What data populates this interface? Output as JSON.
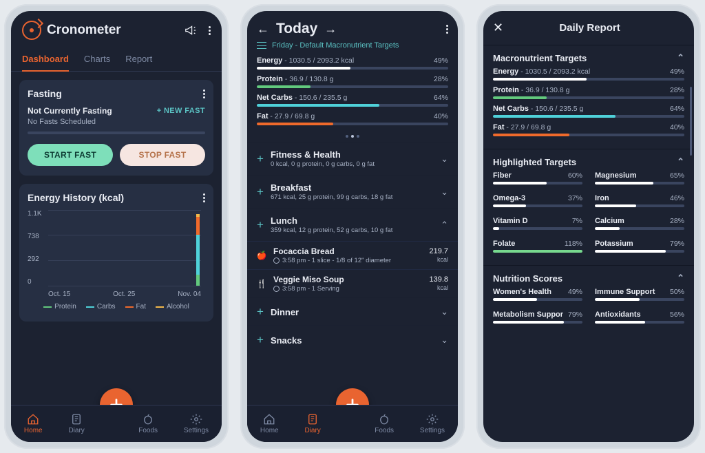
{
  "app_name": "Cronometer",
  "screen1": {
    "tabs": [
      "Dashboard",
      "Charts",
      "Report"
    ],
    "active_tab": 0,
    "fasting": {
      "title": "Fasting",
      "status": "Not Currently Fasting",
      "schedule": "No Fasts Scheduled",
      "new_fast": "+ NEW FAST",
      "start": "START FAST",
      "stop": "STOP FAST"
    },
    "energy_history": {
      "title": "Energy History (kcal)",
      "yticks": [
        "1.1K",
        "738",
        "292",
        "0"
      ],
      "xticks": [
        "Oct. 15",
        "Oct. 25",
        "Nov. 04"
      ],
      "legend": [
        {
          "name": "Protein",
          "color": "#62c97d"
        },
        {
          "name": "Carbs",
          "color": "#4fd1d9"
        },
        {
          "name": "Fat",
          "color": "#f06a2b"
        },
        {
          "name": "Alcohol",
          "color": "#f3b84a"
        }
      ]
    },
    "nav": [
      "Home",
      "Diary",
      "Foods",
      "Settings"
    ],
    "active_nav": 0
  },
  "chart_data": {
    "type": "bar",
    "title": "Energy History (kcal)",
    "ylabel": "kcal",
    "ylim": [
      0,
      1100
    ],
    "x": [
      "Oct. 15",
      "Oct. 25",
      "Nov. 04"
    ],
    "stacked": true,
    "series": [
      {
        "name": "Protein",
        "color": "#62c97d",
        "values": [
          0,
          0,
          150
        ]
      },
      {
        "name": "Carbs",
        "color": "#4fd1d9",
        "values": [
          0,
          0,
          600
        ]
      },
      {
        "name": "Fat",
        "color": "#f06a2b",
        "values": [
          0,
          0,
          250
        ]
      },
      {
        "name": "Alcohol",
        "color": "#f3b84a",
        "values": [
          0,
          0,
          30
        ]
      }
    ],
    "legend": [
      "Protein",
      "Carbs",
      "Fat",
      "Alcohol"
    ]
  },
  "screen2": {
    "title": "Today",
    "subtitle": "Friday - Default Macronutrient Targets",
    "macros": [
      {
        "name": "Energy",
        "value": "1030.5 / 2093.2 kcal",
        "pct": "49%",
        "fill": 49,
        "color": "#ffffff"
      },
      {
        "name": "Protein",
        "value": "36.9 / 130.8 g",
        "pct": "28%",
        "fill": 28,
        "color": "#62c97d"
      },
      {
        "name": "Net Carbs",
        "value": "150.6 / 235.5 g",
        "pct": "64%",
        "fill": 64,
        "color": "#4fd1d9"
      },
      {
        "name": "Fat",
        "value": "27.9 / 69.8 g",
        "pct": "40%",
        "fill": 40,
        "color": "#f06a2b"
      }
    ],
    "groups": [
      {
        "name": "Fitness & Health",
        "sum": "0 kcal, 0 g protein, 0 g carbs, 0 g fat",
        "open": false
      },
      {
        "name": "Breakfast",
        "sum": "671 kcal, 25 g protein, 99 g carbs, 18 g fat",
        "open": false
      },
      {
        "name": "Lunch",
        "sum": "359 kcal, 12 g protein, 52 g carbs, 10 g fat",
        "open": true,
        "items": [
          {
            "name": "Focaccia Bread",
            "time": "3:58 pm",
            "serv": "1 slice - 1/8 of 12\" diameter",
            "val": "219.7",
            "unit": "kcal",
            "icon": "apple"
          },
          {
            "name": "Veggie Miso Soup",
            "time": "3:58 pm",
            "serv": "1 Serving",
            "val": "139.8",
            "unit": "kcal",
            "icon": "cutlery"
          }
        ]
      },
      {
        "name": "Dinner",
        "sum": "",
        "open": false
      },
      {
        "name": "Snacks",
        "sum": "",
        "open": false
      }
    ],
    "nav": [
      "Home",
      "Diary",
      "Foods",
      "Settings"
    ],
    "active_nav": 1
  },
  "screen3": {
    "title": "Daily Report",
    "sections": {
      "macros": {
        "title": "Macronutrient Targets",
        "rows": [
          {
            "name": "Energy",
            "value": "1030.5 / 2093.2 kcal",
            "pct": "49%",
            "fill": 49,
            "color": "#ffffff"
          },
          {
            "name": "Protein",
            "value": "36.9 / 130.8 g",
            "pct": "28%",
            "fill": 28,
            "color": "#62c97d"
          },
          {
            "name": "Net Carbs",
            "value": "150.6 / 235.5 g",
            "pct": "64%",
            "fill": 64,
            "color": "#4fd1d9"
          },
          {
            "name": "Fat",
            "value": "27.9 / 69.8 g",
            "pct": "40%",
            "fill": 40,
            "color": "#f06a2b"
          }
        ]
      },
      "highlights": {
        "title": "Highlighted Targets",
        "rows": [
          {
            "name": "Fiber",
            "pct": "60%",
            "fill": 60,
            "color": "#fff"
          },
          {
            "name": "Magnesium",
            "pct": "65%",
            "fill": 65,
            "color": "#fff"
          },
          {
            "name": "Omega-3",
            "pct": "37%",
            "fill": 37,
            "color": "#fff"
          },
          {
            "name": "Iron",
            "pct": "46%",
            "fill": 46,
            "color": "#fff"
          },
          {
            "name": "Vitamin D",
            "pct": "7%",
            "fill": 7,
            "color": "#fff"
          },
          {
            "name": "Calcium",
            "pct": "28%",
            "fill": 28,
            "color": "#fff"
          },
          {
            "name": "Folate",
            "pct": "118%",
            "fill": 100,
            "color": "#77d98e"
          },
          {
            "name": "Potassium",
            "pct": "79%",
            "fill": 79,
            "color": "#fff"
          }
        ]
      },
      "scores": {
        "title": "Nutrition Scores",
        "rows": [
          {
            "name": "Women's Health",
            "pct": "49%",
            "fill": 49,
            "color": "#fff"
          },
          {
            "name": "Immune Support",
            "pct": "50%",
            "fill": 50,
            "color": "#fff"
          },
          {
            "name": "Metabolism Suppor",
            "pct": "79%",
            "fill": 79,
            "color": "#fff"
          },
          {
            "name": "Antioxidants",
            "pct": "56%",
            "fill": 56,
            "color": "#fff"
          }
        ]
      }
    }
  }
}
